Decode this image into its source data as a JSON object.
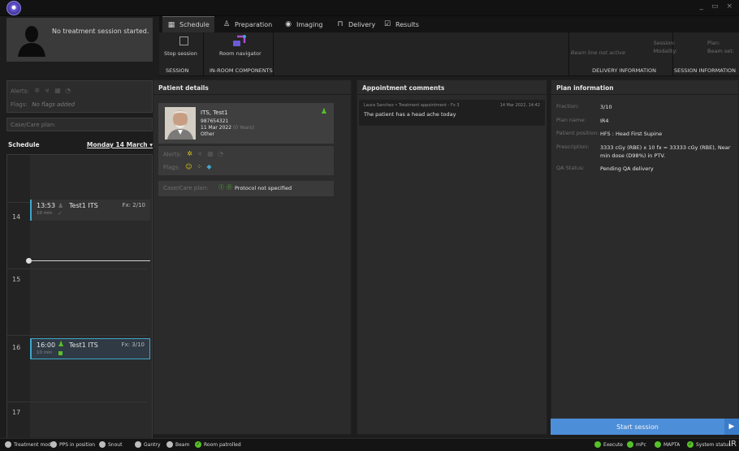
{
  "window": {
    "controls": [
      "_",
      "▭",
      "×"
    ]
  },
  "session_card": {
    "text": "No treatment session started."
  },
  "left_panel": {
    "alerts_label": "Alerts:",
    "flags_label": "Flags:",
    "flags_value": "No flags added",
    "casecare_label": "Case/Care plan:"
  },
  "schedule": {
    "title": "Schedule",
    "date": "Monday 14 March",
    "hours": [
      "14",
      "15",
      "16",
      "17"
    ],
    "appointments": [
      {
        "time": "13:53",
        "duration": "10 min",
        "patient": "Test1 ITS",
        "fx": "Fx: 2/10",
        "status": "done"
      },
      {
        "time": "16:00",
        "duration": "10 min",
        "patient": "Test1 ITS",
        "fx": "Fx: 3/10",
        "status": "selected"
      }
    ]
  },
  "tabs": [
    {
      "label": "Schedule",
      "icon": "calendar-icon",
      "active": true
    },
    {
      "label": "Preparation",
      "icon": "person-icon",
      "active": false
    },
    {
      "label": "Imaging",
      "icon": "imaging-icon",
      "active": false
    },
    {
      "label": "Delivery",
      "icon": "delivery-icon",
      "active": false
    },
    {
      "label": "Results",
      "icon": "results-icon",
      "active": false
    }
  ],
  "toolbar": {
    "stop_session": "Stop session",
    "session_group": "SESSION",
    "room_navigator": "Room navigator",
    "in_room_group": "IN-ROOM COMPONENTS",
    "beam_status": "Beam line not active",
    "delivery_info": "DELIVERY INFORMATION",
    "session_info": "SESSION INFORMATION",
    "session_key": "Session:",
    "modality_key": "Modality:",
    "plan_key": "Plan:",
    "beamset_key": "Beam set:"
  },
  "patient_details": {
    "title": "Patient details",
    "name": "ITS, Test1",
    "id": "987654321",
    "dob": "11 Mar 2022",
    "age": "(0 Years)",
    "sex": "Other",
    "alerts_label": "Alerts:",
    "flags_label": "Flags:",
    "casecare_label": "Case/Care plan:",
    "protocol": "Protocol not specified"
  },
  "comments": {
    "title": "Appointment comments",
    "items": [
      {
        "meta": "Laura Sanchez • Treatment appointment - Fx 3",
        "date": "14 Mar 2022, 14:42",
        "text": "The patient has a head ache today"
      }
    ]
  },
  "plan_info": {
    "title": "Plan information",
    "rows": [
      {
        "key": "Fraction:",
        "value": "3/10"
      },
      {
        "key": "Plan name:",
        "value": "IR4"
      },
      {
        "key": "Patient position:",
        "value": "HFS : Head First Supine"
      },
      {
        "key": "Prescription:",
        "value": "3333 cGy (RBE) x 10 fx = 33333 cGy (RBE), Near min dose (D98%) in PTV."
      },
      {
        "key": "QA Status:",
        "value": "Pending QA delivery"
      }
    ],
    "start_button": "Start session"
  },
  "statusbar": {
    "left": [
      {
        "label": "Treatment mode",
        "state": "grey"
      },
      {
        "label": "PPS in position",
        "state": "grey"
      },
      {
        "label": "Snout",
        "state": "grey"
      },
      {
        "label": "Gantry",
        "state": "grey"
      },
      {
        "label": "Beam",
        "state": "grey"
      },
      {
        "label": "Room patrolled",
        "state": "check"
      }
    ],
    "right": [
      {
        "label": "Execute",
        "state": "green"
      },
      {
        "label": "mPc",
        "state": "green"
      },
      {
        "label": "MAPTA",
        "state": "green"
      },
      {
        "label": "System status",
        "state": "check"
      }
    ],
    "brand": "IR"
  },
  "colors": {
    "accent": "#4d8ed8",
    "selected_border": "#3fa7c9",
    "ok_green": "#56c02a",
    "alert_yellow": "#d6c21a"
  }
}
